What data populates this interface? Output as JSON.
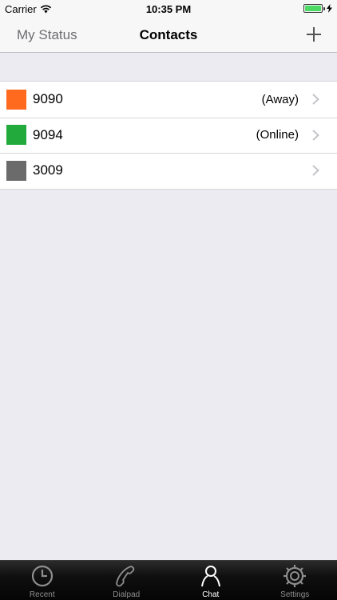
{
  "status_bar": {
    "carrier": "Carrier",
    "time": "10:35 PM",
    "battery_color": "#4cd964"
  },
  "nav": {
    "left_label": "My Status",
    "title": "Contacts",
    "add_icon": "plus-icon"
  },
  "contacts": [
    {
      "name": "9090",
      "status": "(Away)",
      "color": "#ff6a1f"
    },
    {
      "name": "9094",
      "status": "(Online)",
      "color": "#22aa3c"
    },
    {
      "name": "3009",
      "status": "",
      "color": "#6b6b6b"
    }
  ],
  "tabs": [
    {
      "label": "Recent",
      "icon": "clock-icon",
      "active": false
    },
    {
      "label": "Dialpad",
      "icon": "phone-icon",
      "active": false
    },
    {
      "label": "Chat",
      "icon": "person-icon",
      "active": true
    },
    {
      "label": "Settings",
      "icon": "gear-icon",
      "active": false
    }
  ]
}
